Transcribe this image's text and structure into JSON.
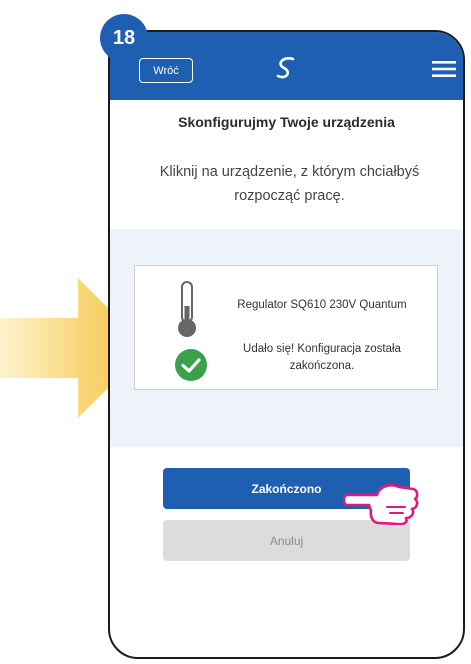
{
  "step_badge": "18",
  "header": {
    "back_label": "Wróć",
    "logo_icon": "salus-logo-icon",
    "menu_icon": "hamburger-menu-icon",
    "background_color": "#1f5fb1"
  },
  "content": {
    "heading": "Skonfigurujmy Twoje urządzenia",
    "subtitle": "Kliknij na urządzenie, z którym chciałbyś rozpocząć pracę."
  },
  "device_card": {
    "device_icon": "thermometer-icon",
    "device_name": "Regulator SQ610 230V Quantum",
    "status_icon": "check-circle-icon",
    "status_color": "#3aa14a",
    "status_text": "Udało się! Konfiguracja została zakończona."
  },
  "buttons": {
    "finish_label": "Zakończono",
    "cancel_label": "Anuluj"
  },
  "annotations": {
    "pointer_icon": "pointing-hand-icon",
    "arrow_icon": "yellow-arrow-icon"
  }
}
